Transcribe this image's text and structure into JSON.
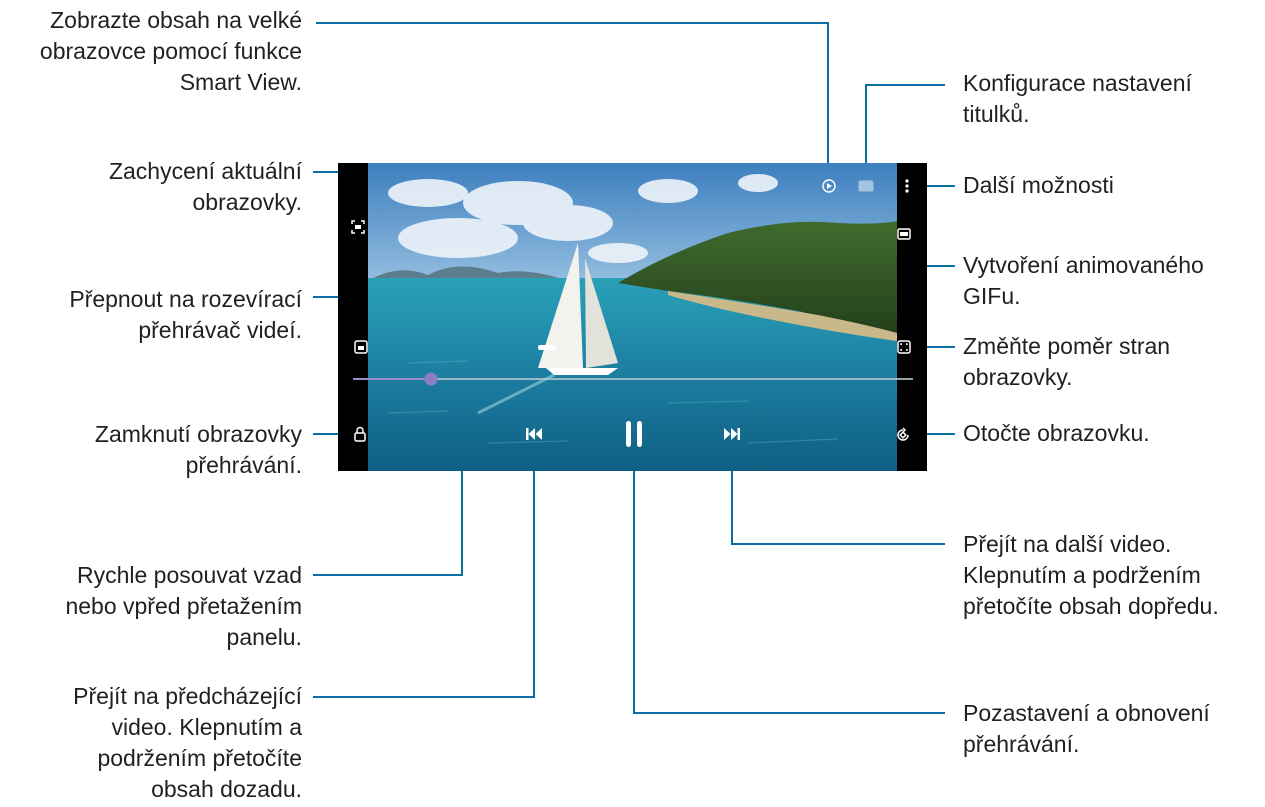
{
  "annotations": {
    "smart_view": [
      "Zobrazte obsah na velké",
      "obrazovce pomocí funkce",
      "Smart View."
    ],
    "subtitles": [
      "Konfigurace nastavení",
      "titulků."
    ],
    "capture": [
      "Zachycení aktuální",
      "obrazovky."
    ],
    "more_options": [
      "Další možnosti"
    ],
    "popup_player": [
      "Přepnout na rozevírací",
      "přehrávač videí."
    ],
    "gif": [
      "Vytvoření animovaného",
      "GIFu."
    ],
    "aspect_ratio": [
      "Změňte poměr stran",
      "obrazovky."
    ],
    "lock": [
      "Zamknutí obrazovky",
      "přehrávání."
    ],
    "rotate": [
      "Otočte obrazovku."
    ],
    "seek_bar": [
      "Rychle posouvat vzad",
      "nebo vpřed přetažením",
      "panelu."
    ],
    "next_video": [
      "Přejít na další video.",
      "Klepnutím a podržením",
      "přetočíte obsah dopředu."
    ],
    "pause": [
      "Pozastavení a obnovení",
      "přehrávání."
    ],
    "previous_video": [
      "Přejít na předcházející",
      "video. Klepnutím a",
      "podržením přetočíte",
      "obsah dozadu."
    ]
  },
  "player": {
    "progress": 0.14
  },
  "colors": {
    "leader_line": "#0b6fa4",
    "text": "#231f20",
    "sky": "#4d8ec5",
    "sea": "#1f88a6"
  }
}
